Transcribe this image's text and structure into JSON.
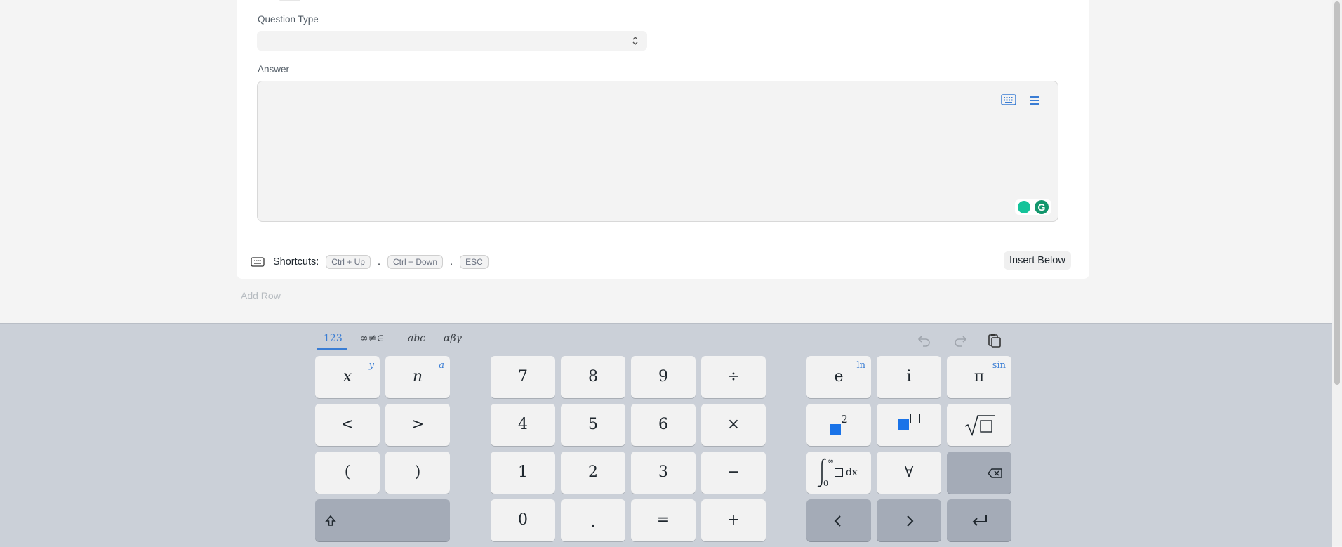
{
  "form": {
    "question_type_label": "Question Type",
    "question_type_value": "",
    "answer_label": "Answer",
    "shortcuts_label": "Shortcuts:",
    "shortcut_keys": [
      "Ctrl + Up",
      "Ctrl + Down",
      "ESC"
    ],
    "separator": ".",
    "insert_below_label": "Insert Below",
    "add_row_label": "Add Row"
  },
  "keyboard": {
    "tabs": [
      "123",
      "∞≠∈",
      "abc",
      "αβγ"
    ],
    "active_tab": "123",
    "keys": {
      "x": "x",
      "x_shift": "y",
      "n": "n",
      "n_shift": "a",
      "lt": "<",
      "gt": ">",
      "lparen": "(",
      "rparen": ")",
      "seven": "7",
      "eight": "8",
      "nine": "9",
      "divide": "÷",
      "four": "4",
      "five": "5",
      "six": "6",
      "times": "×",
      "one": "1",
      "two": "2",
      "three": "3",
      "minus": "−",
      "zero": "0",
      "decimal": ".",
      "equals": "=",
      "plus": "+",
      "e": "e",
      "e_shift": "ln",
      "i": "i",
      "pi": "π",
      "pi_shift": "sin",
      "square_exp": "2",
      "integral_lower": "0",
      "integral_upper": "∞",
      "integral_dx": "dx",
      "forall": "∀"
    }
  },
  "colors": {
    "accent": "#3a7dd4",
    "keyboard_bg": "#cbd0d8",
    "grammarly": "#15c39a"
  }
}
